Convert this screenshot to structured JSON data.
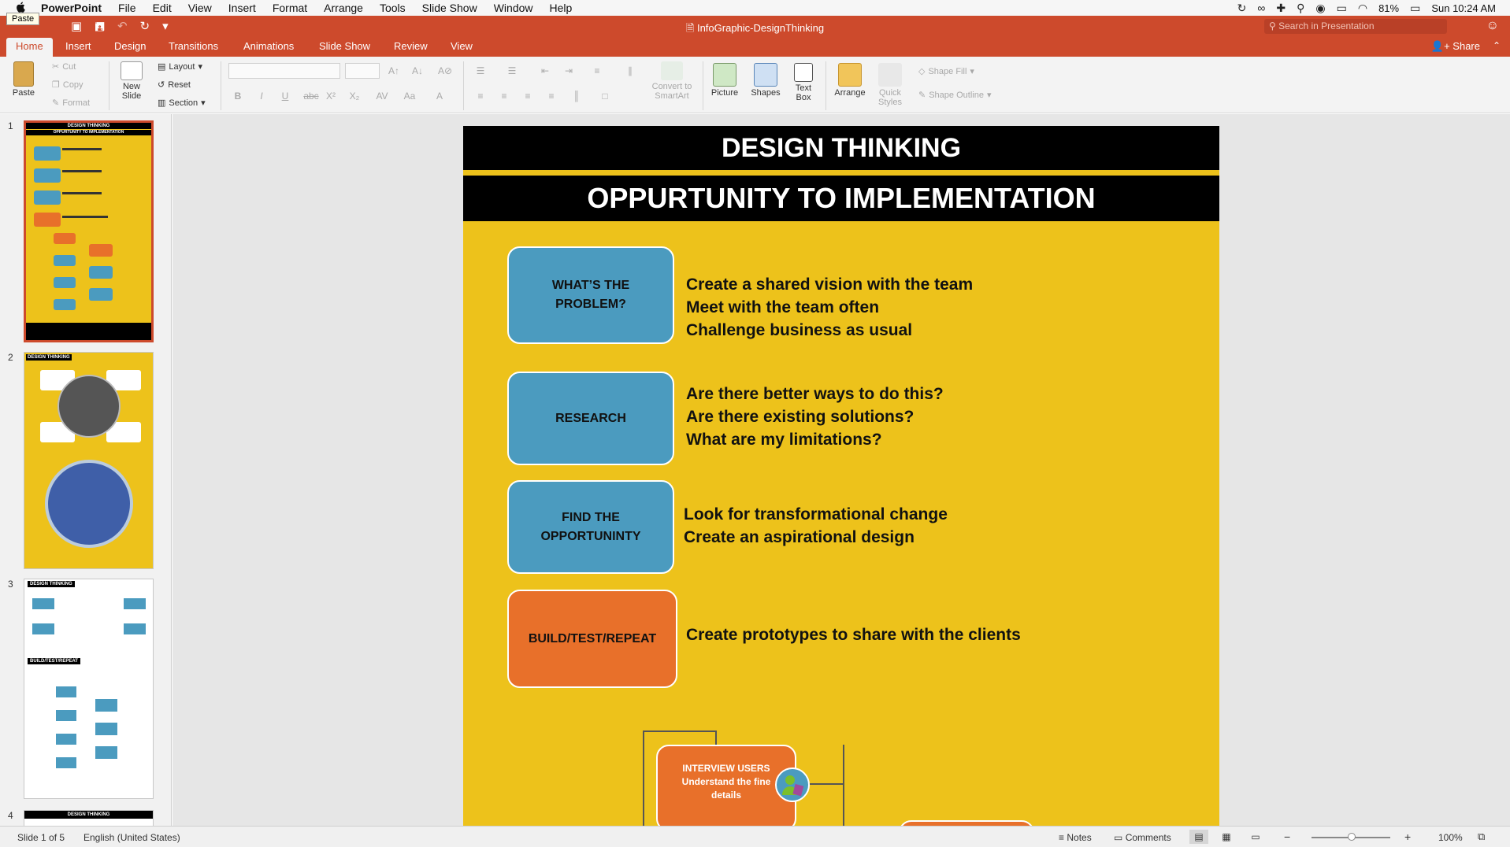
{
  "menubar": {
    "app_name": "PowerPoint",
    "items": [
      "File",
      "Edit",
      "View",
      "Insert",
      "Format",
      "Arrange",
      "Tools",
      "Slide Show",
      "Window",
      "Help"
    ],
    "battery": "81%",
    "clock": "Sun 10:24 AM"
  },
  "tooltip": {
    "text": "Paste"
  },
  "titlebar": {
    "document_title": "InfoGraphic-DesignThinking",
    "search_placeholder": "Search in Presentation"
  },
  "ribbon_tabs": [
    "Home",
    "Insert",
    "Design",
    "Transitions",
    "Animations",
    "Slide Show",
    "Review",
    "View"
  ],
  "share_label": "Share",
  "ribbon": {
    "paste": "Paste",
    "cut": "Cut",
    "copy": "Copy",
    "format": "Format",
    "new_slide": [
      "New",
      "Slide"
    ],
    "layout": "Layout",
    "reset": "Reset",
    "section": "Section",
    "convert_smartart": [
      "Convert to",
      "SmartArt"
    ],
    "picture": "Picture",
    "shapes": "Shapes",
    "text_box": [
      "Text",
      "Box"
    ],
    "arrange": "Arrange",
    "quick_styles": [
      "Quick",
      "Styles"
    ],
    "shape_fill": "Shape Fill",
    "shape_outline": "Shape Outline"
  },
  "thumbnails": {
    "numbers": [
      "1",
      "2",
      "3",
      "4"
    ],
    "t1_title": "DESIGN THINKING",
    "t1_sub": "OPPURTUNITY TO IMPLEMENTATION",
    "t2_title": "DESIGN THINKING",
    "t3_title": "DESIGN THINKING",
    "t3_sub": "BUILD/TEST/REPEAT",
    "t4_title": "DESIGN THINKING"
  },
  "slide": {
    "title": "DESIGN THINKING",
    "subtitle": "OPPURTUNITY TO IMPLEMENTATION",
    "rows": [
      {
        "label": [
          "WHAT’S THE",
          "PROBLEM?"
        ],
        "lines": [
          "Create a shared vision with the team",
          "Meet with the team often",
          "Challenge business as usual"
        ]
      },
      {
        "label": [
          "RESEARCH"
        ],
        "lines": [
          "Are there better ways to do this?",
          "Are there existing solutions?",
          "What are my limitations?"
        ]
      },
      {
        "label": [
          "FIND THE",
          "OPPORTUNINTY"
        ],
        "lines": [
          "Look for transformational change",
          "Create an aspirational design"
        ]
      },
      {
        "label": [
          "BUILD/TEST/REPEAT"
        ],
        "lines": [
          "Create prototypes to share with the clients"
        ]
      }
    ],
    "flow_box": [
      "INTERVIEW USERS",
      "Understand the fine",
      "details"
    ]
  },
  "statusbar": {
    "slide_count": "Slide 1 of 5",
    "language": "English (United States)",
    "notes": "Notes",
    "comments": "Comments",
    "zoom": "100%"
  },
  "colors": {
    "accent": "#cd4a2c",
    "slide_yellow": "#edc21b",
    "box_blue": "#4b9bbf",
    "box_orange": "#e8702a"
  }
}
